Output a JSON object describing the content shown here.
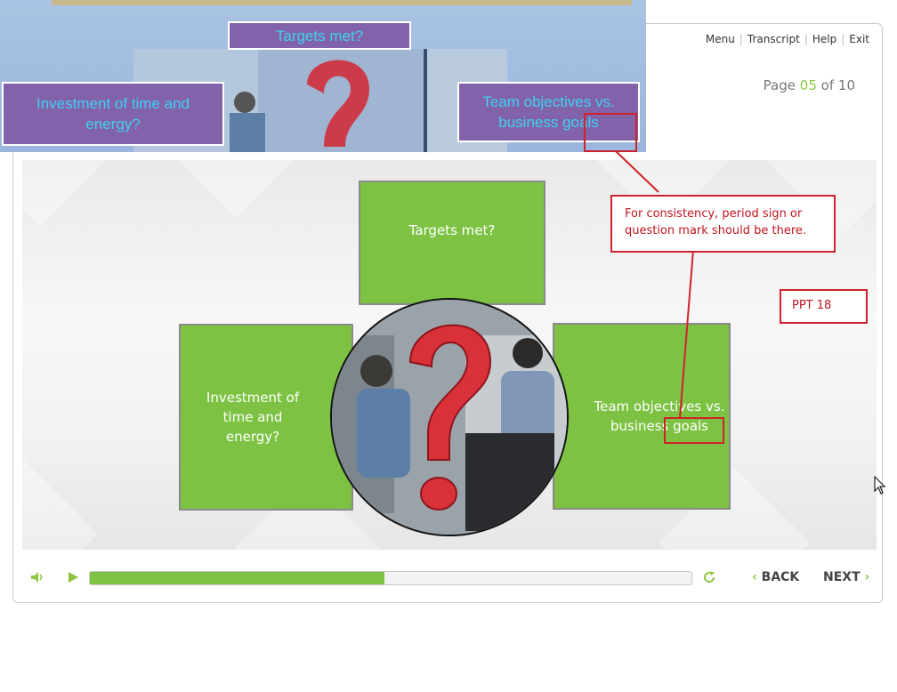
{
  "player": {
    "top_nav": [
      "Menu",
      "Transcript",
      "Help",
      "Exit"
    ],
    "page_label": "Page",
    "page_current": "05",
    "page_of": "of",
    "page_total": "10",
    "controls": {
      "volume_icon": "speaker-icon",
      "play_icon": "play-icon",
      "replay_icon": "replay-icon",
      "progress": 0.49,
      "back_label": "BACK",
      "next_label": "NEXT",
      "accent_color": "#7dc243"
    }
  },
  "slide": {
    "top_box": "Targets met?",
    "left_box": "Investment of time and energy?",
    "right_box": "Team objectives vs. business goals",
    "image": "question-mark-meeting-photo"
  },
  "reference_slide": {
    "top_box": "Targets met?",
    "left_box": "Investment of time and energy?",
    "right_box": "Team objectives vs. business goals"
  },
  "annotations": {
    "comment": "For consistency, period sign or question mark should be there.",
    "ppt_ref": "PPT 18",
    "color": "#d0222a"
  }
}
